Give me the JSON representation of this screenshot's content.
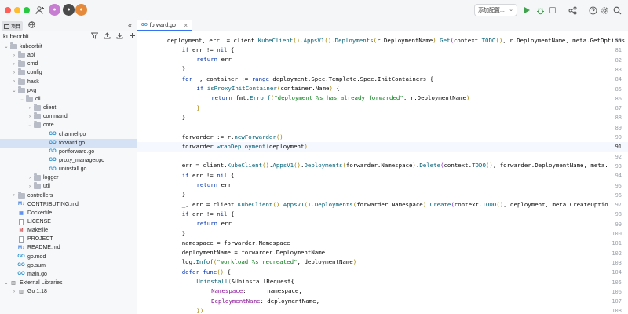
{
  "titlebar": {
    "config_label": "添加配置..."
  },
  "project_panel": {
    "tab_label": "项目",
    "root": "kubeorbit"
  },
  "tree": [
    {
      "label": "kubeorbit",
      "depth": 0,
      "arrow": "open",
      "icon": "folder"
    },
    {
      "label": "api",
      "depth": 1,
      "arrow": "closed",
      "icon": "folder"
    },
    {
      "label": "cmd",
      "depth": 1,
      "arrow": "closed",
      "icon": "folder"
    },
    {
      "label": "config",
      "depth": 1,
      "arrow": "closed",
      "icon": "folder"
    },
    {
      "label": "hack",
      "depth": 1,
      "arrow": "closed",
      "icon": "folder"
    },
    {
      "label": "pkg",
      "depth": 1,
      "arrow": "open",
      "icon": "folder"
    },
    {
      "label": "cli",
      "depth": 2,
      "arrow": "open",
      "icon": "folder"
    },
    {
      "label": "client",
      "depth": 3,
      "arrow": "closed",
      "icon": "folder"
    },
    {
      "label": "command",
      "depth": 3,
      "arrow": "closed",
      "icon": "folder"
    },
    {
      "label": "core",
      "depth": 3,
      "arrow": "open",
      "icon": "folder"
    },
    {
      "label": "channel.go",
      "depth": 5,
      "arrow": "none",
      "icon": "go"
    },
    {
      "label": "forward.go",
      "depth": 5,
      "arrow": "none",
      "icon": "go",
      "selected": true
    },
    {
      "label": "portforward.go",
      "depth": 5,
      "arrow": "none",
      "icon": "go"
    },
    {
      "label": "proxy_manager.go",
      "depth": 5,
      "arrow": "none",
      "icon": "go"
    },
    {
      "label": "uninstall.go",
      "depth": 5,
      "arrow": "none",
      "icon": "go"
    },
    {
      "label": "logger",
      "depth": 3,
      "arrow": "closed",
      "icon": "folder"
    },
    {
      "label": "util",
      "depth": 3,
      "arrow": "closed",
      "icon": "folder"
    },
    {
      "label": "controllers",
      "depth": 1,
      "arrow": "closed",
      "icon": "folder"
    },
    {
      "label": "CONTRIBUTING.md",
      "depth": 1,
      "arrow": "none",
      "icon": "md"
    },
    {
      "label": "Dockerfile",
      "depth": 1,
      "arrow": "none",
      "icon": "docker"
    },
    {
      "label": "LICENSE",
      "depth": 1,
      "arrow": "none",
      "icon": "doc"
    },
    {
      "label": "Makefile",
      "depth": 1,
      "arrow": "none",
      "icon": "make"
    },
    {
      "label": "PROJECT",
      "depth": 1,
      "arrow": "none",
      "icon": "doc"
    },
    {
      "label": "README.md",
      "depth": 1,
      "arrow": "none",
      "icon": "md"
    },
    {
      "label": "go.mod",
      "depth": 1,
      "arrow": "none",
      "icon": "go"
    },
    {
      "label": "go.sum",
      "depth": 1,
      "arrow": "none",
      "icon": "go"
    },
    {
      "label": "main.go",
      "depth": 1,
      "arrow": "none",
      "icon": "go"
    },
    {
      "label": "External Libraries",
      "depth": 0,
      "arrow": "open",
      "icon": "lib"
    },
    {
      "label": "Go 1.18",
      "depth": 1,
      "arrow": "closed",
      "icon": "lib"
    }
  ],
  "editor": {
    "tab_label": "forward.go",
    "current_line": 91,
    "lines": [
      {
        "n": "80",
        "indent": 0,
        "tokens": [
          [
            "deployment, err := client.",
            ""
          ],
          [
            "KubeClient",
            "fn"
          ],
          [
            "()",
            "paren-a"
          ],
          [
            ".",
            ""
          ],
          [
            "AppsV1",
            "fn"
          ],
          [
            "()",
            "paren-a"
          ],
          [
            ".",
            ""
          ],
          [
            "Deployments",
            "fn"
          ],
          [
            "(",
            "paren-a"
          ],
          [
            "r.DeploymentName",
            ""
          ],
          [
            ")",
            "paren-a"
          ],
          [
            ".",
            ""
          ],
          [
            "Get",
            "fn"
          ],
          [
            "(",
            "paren-b"
          ],
          [
            "context.",
            ""
          ],
          [
            "TODO",
            "fn"
          ],
          [
            "()",
            "paren-a"
          ],
          [
            ", r.DeploymentName, meta.GetOptions",
            ""
          ]
        ]
      },
      {
        "n": "81",
        "indent": 1,
        "tokens": [
          [
            "if",
            "kw"
          ],
          [
            " err != ",
            ""
          ],
          [
            "nil",
            "kw"
          ],
          [
            " {",
            ""
          ]
        ]
      },
      {
        "n": "82",
        "indent": 2,
        "tokens": [
          [
            "return",
            "kw"
          ],
          [
            " err",
            ""
          ]
        ]
      },
      {
        "n": "83",
        "indent": 1,
        "tokens": [
          [
            "}",
            ""
          ]
        ]
      },
      {
        "n": "84",
        "indent": 1,
        "tokens": [
          [
            "for",
            "kw"
          ],
          [
            " _, container := ",
            ""
          ],
          [
            "range",
            "kw"
          ],
          [
            " deployment.Spec.Template.Spec.InitContainers {",
            ""
          ]
        ]
      },
      {
        "n": "85",
        "indent": 2,
        "tokens": [
          [
            "if",
            "kw"
          ],
          [
            " ",
            ""
          ],
          [
            "isProxyInitContainer",
            "fn"
          ],
          [
            "(",
            "paren-a"
          ],
          [
            "container.Name",
            ""
          ],
          [
            ")",
            "paren-a"
          ],
          [
            " {",
            ""
          ]
        ]
      },
      {
        "n": "86",
        "indent": 3,
        "tokens": [
          [
            "return",
            "kw"
          ],
          [
            " fmt.",
            ""
          ],
          [
            "Errorf",
            "fn"
          ],
          [
            "(",
            "paren-a"
          ],
          [
            "\"deployment %s has already forwarded\"",
            "str"
          ],
          [
            ", r.DeploymentName",
            ""
          ],
          [
            ")",
            "paren-a"
          ]
        ]
      },
      {
        "n": "87",
        "indent": 2,
        "tokens": [
          [
            "}",
            "paren-a"
          ]
        ]
      },
      {
        "n": "88",
        "indent": 1,
        "tokens": [
          [
            "}",
            ""
          ]
        ]
      },
      {
        "n": "89",
        "indent": 0,
        "tokens": []
      },
      {
        "n": "90",
        "indent": 1,
        "tokens": [
          [
            "forwarder := r.",
            ""
          ],
          [
            "newForwarder",
            "fn"
          ],
          [
            "()",
            "paren-a"
          ]
        ]
      },
      {
        "n": "91",
        "indent": 1,
        "tokens": [
          [
            "forwarder.",
            ""
          ],
          [
            "wrapDeployment",
            "fn"
          ],
          [
            "(",
            "paren-a"
          ],
          [
            "deployment",
            ""
          ],
          [
            ")",
            "paren-a"
          ]
        ]
      },
      {
        "n": "92",
        "indent": 0,
        "tokens": []
      },
      {
        "n": "93",
        "indent": 1,
        "tokens": [
          [
            "err = client.",
            ""
          ],
          [
            "KubeClient",
            "fn"
          ],
          [
            "()",
            "paren-a"
          ],
          [
            ".",
            ""
          ],
          [
            "AppsV1",
            "fn"
          ],
          [
            "()",
            "paren-a"
          ],
          [
            ".",
            ""
          ],
          [
            "Deployments",
            "fn"
          ],
          [
            "(",
            "paren-a"
          ],
          [
            "forwarder.Namespace",
            ""
          ],
          [
            ")",
            "paren-a"
          ],
          [
            ".",
            ""
          ],
          [
            "Delete",
            "fn"
          ],
          [
            "(",
            "paren-b"
          ],
          [
            "context.",
            ""
          ],
          [
            "TODO",
            "fn"
          ],
          [
            "()",
            "paren-a"
          ],
          [
            ", forwarder.DeploymentName, meta.",
            ""
          ]
        ]
      },
      {
        "n": "94",
        "indent": 1,
        "tokens": [
          [
            "if",
            "kw"
          ],
          [
            " err != ",
            ""
          ],
          [
            "nil",
            "kw"
          ],
          [
            " {",
            ""
          ]
        ]
      },
      {
        "n": "95",
        "indent": 2,
        "tokens": [
          [
            "return",
            "kw"
          ],
          [
            " err",
            ""
          ]
        ]
      },
      {
        "n": "96",
        "indent": 1,
        "tokens": [
          [
            "}",
            ""
          ]
        ]
      },
      {
        "n": "97",
        "indent": 1,
        "tokens": [
          [
            "_, err = client.",
            ""
          ],
          [
            "KubeClient",
            "fn"
          ],
          [
            "()",
            "paren-a"
          ],
          [
            ".",
            ""
          ],
          [
            "AppsV1",
            "fn"
          ],
          [
            "()",
            "paren-a"
          ],
          [
            ".",
            ""
          ],
          [
            "Deployments",
            "fn"
          ],
          [
            "(",
            "paren-a"
          ],
          [
            "forwarder.Namespace",
            ""
          ],
          [
            ")",
            "paren-a"
          ],
          [
            ".",
            ""
          ],
          [
            "Create",
            "fn"
          ],
          [
            "(",
            "paren-b"
          ],
          [
            "context.",
            ""
          ],
          [
            "TODO",
            "fn"
          ],
          [
            "()",
            "paren-a"
          ],
          [
            ", deployment, meta.CreateOptio",
            ""
          ]
        ]
      },
      {
        "n": "98",
        "indent": 1,
        "tokens": [
          [
            "if",
            "kw"
          ],
          [
            " err != ",
            ""
          ],
          [
            "nil",
            "kw"
          ],
          [
            " {",
            ""
          ]
        ]
      },
      {
        "n": "99",
        "indent": 2,
        "tokens": [
          [
            "return",
            "kw"
          ],
          [
            " err",
            ""
          ]
        ]
      },
      {
        "n": "100",
        "indent": 1,
        "tokens": [
          [
            "}",
            ""
          ]
        ]
      },
      {
        "n": "101",
        "indent": 1,
        "tokens": [
          [
            "namespace = forwarder.Namespace",
            ""
          ]
        ]
      },
      {
        "n": "102",
        "indent": 1,
        "tokens": [
          [
            "deploymentName = forwarder.DeploymentName",
            ""
          ]
        ]
      },
      {
        "n": "103",
        "indent": 1,
        "tokens": [
          [
            "log.",
            ""
          ],
          [
            "Infof",
            "fn"
          ],
          [
            "(",
            "paren-a"
          ],
          [
            "\"workload %s recreated\"",
            "str"
          ],
          [
            ", deploymentName",
            ""
          ],
          [
            ")",
            "paren-a"
          ]
        ]
      },
      {
        "n": "104",
        "indent": 1,
        "tokens": [
          [
            "defer",
            "kw"
          ],
          [
            " ",
            ""
          ],
          [
            "func",
            "kw"
          ],
          [
            "()",
            "paren-a"
          ],
          [
            " {",
            ""
          ]
        ]
      },
      {
        "n": "105",
        "indent": 2,
        "tokens": [
          [
            "Uninstall",
            "fn"
          ],
          [
            "(",
            "paren-a"
          ],
          [
            "&UninstallRequest{",
            ""
          ]
        ]
      },
      {
        "n": "106",
        "indent": 3,
        "tokens": [
          [
            "Namespace",
            "fld"
          ],
          [
            ":      namespace,",
            ""
          ]
        ]
      },
      {
        "n": "107",
        "indent": 3,
        "tokens": [
          [
            "DeploymentName",
            "fld"
          ],
          [
            ": deploymentName,",
            ""
          ]
        ]
      },
      {
        "n": "108",
        "indent": 2,
        "tokens": [
          [
            "})",
            "paren-a"
          ]
        ]
      }
    ]
  },
  "colors": {
    "accent": "#3574f0",
    "selection": "#d5e1f5",
    "run_green": "#3fa34d"
  }
}
